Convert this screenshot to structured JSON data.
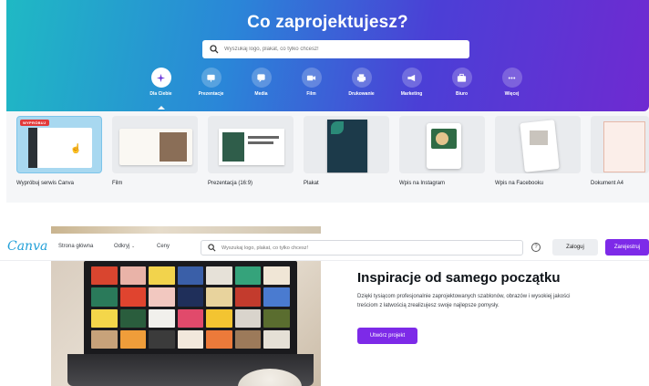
{
  "hero": {
    "title": "Co zaprojektujesz?",
    "search_placeholder": "Wyszukaj logo, plakat, co tylko chcesz!",
    "categories": [
      {
        "label": "Dla Ciebie",
        "icon": "sparkle-icon",
        "active": true
      },
      {
        "label": "Prezentacje",
        "icon": "presentation-icon",
        "active": false
      },
      {
        "label": "Media",
        "icon": "heart-chat-icon",
        "active": false
      },
      {
        "label": "Film",
        "icon": "video-camera-icon",
        "active": false
      },
      {
        "label": "Drukowanie",
        "icon": "printer-icon",
        "active": false
      },
      {
        "label": "Marketing",
        "icon": "megaphone-icon",
        "active": false
      },
      {
        "label": "Biuro",
        "icon": "briefcase-icon",
        "active": false
      },
      {
        "label": "Więcej",
        "icon": "more-dots-icon",
        "active": false
      }
    ]
  },
  "templates": [
    {
      "name": "Wypróbuj serwis Canva",
      "badge": "WYPRÓBUJ"
    },
    {
      "name": "Film"
    },
    {
      "name": "Prezentacja (16:9)"
    },
    {
      "name": "Plakat"
    },
    {
      "name": "Wpis na Instagram"
    },
    {
      "name": "Wpis na Facebooku"
    },
    {
      "name": "Dokument A4"
    }
  ],
  "nav": {
    "logo": "Canva",
    "links": [
      "Strona główna",
      "Odkryj",
      "Ceny"
    ],
    "search_placeholder": "Wyszukaj logo, plakat, co tylko chcesz!",
    "help": "?",
    "login": "Zaloguj",
    "register": "Zarejestruj"
  },
  "promo": {
    "title": "Inspiracje od samego początku",
    "description": "Dzięki tysiącom profesjonalnie zaprojektowanych szablonów, obrazów i wysokiej jakości treściom z łatwością zrealizujesz swoje najlepsze pomysły.",
    "cta": "Utwórz projekt"
  },
  "colors": {
    "accent": "#7d2ae8",
    "logo": "#22a0d8"
  }
}
